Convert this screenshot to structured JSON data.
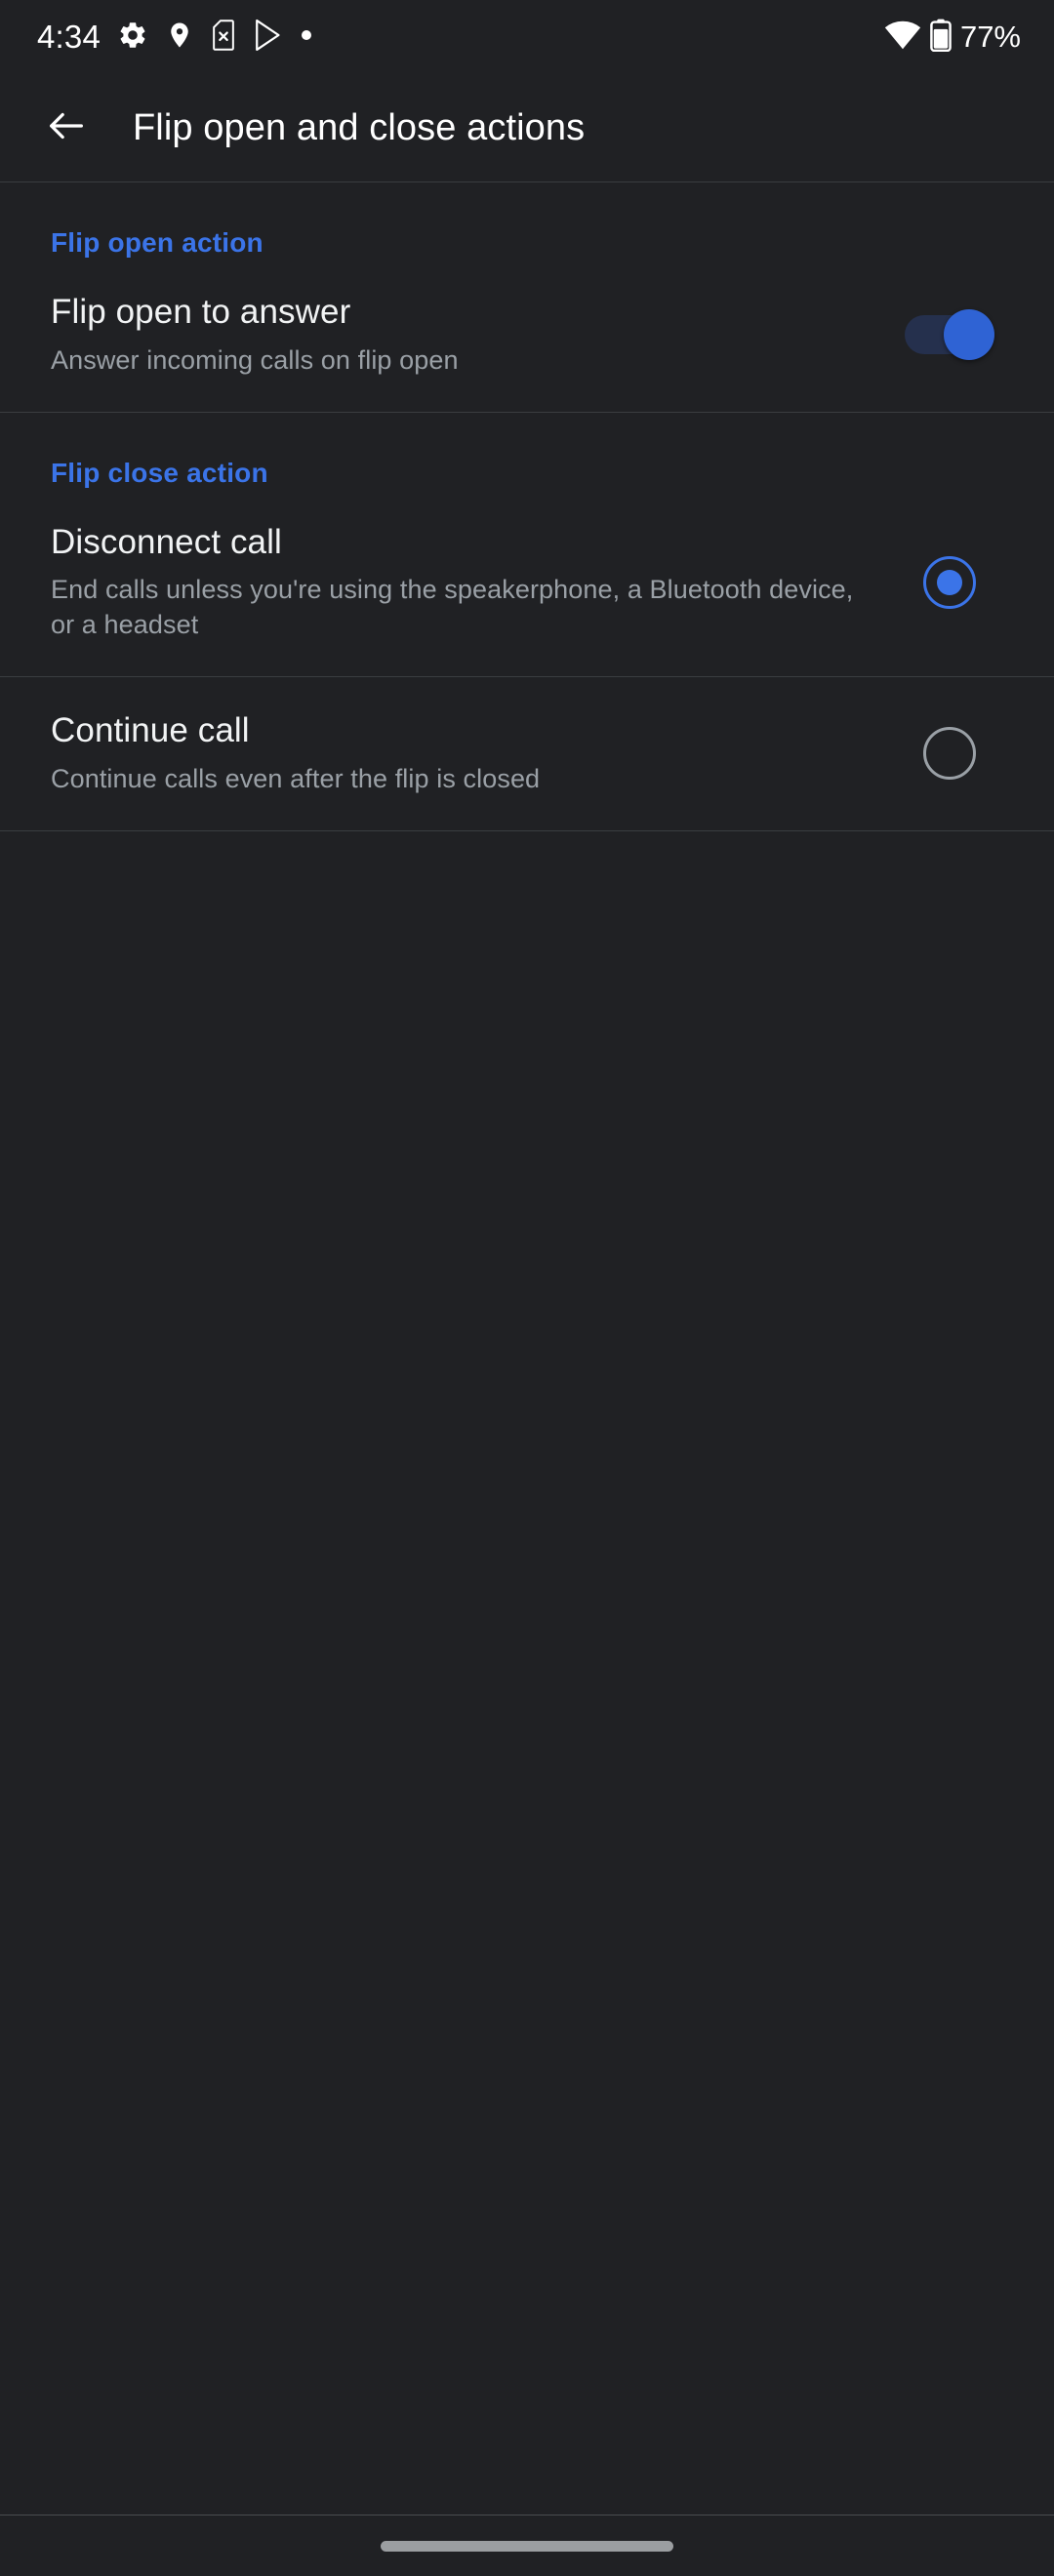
{
  "status_bar": {
    "clock": "4:34",
    "battery_percent": "77%",
    "left_icons": [
      "settings-gear-icon",
      "location-pin-icon",
      "sim-card-missing-icon",
      "play-store-icon",
      "dot-icon"
    ],
    "right_icons": [
      "wifi-icon",
      "battery-icon"
    ]
  },
  "app_bar": {
    "back_icon": "arrow-back-icon",
    "title": "Flip open and close actions"
  },
  "sections": [
    {
      "header": "Flip open action",
      "rows": [
        {
          "title": "Flip open to answer",
          "summary": "Answer incoming calls on flip open",
          "control": "switch",
          "checked": true
        }
      ]
    },
    {
      "header": "Flip close action",
      "rows": [
        {
          "title": "Disconnect call",
          "summary": "End calls unless you're using the speakerphone, a Bluetooth device, or a headset",
          "control": "radio",
          "checked": true
        },
        {
          "title": "Continue call",
          "summary": "Continue calls even after the flip is closed",
          "control": "radio",
          "checked": false
        }
      ]
    }
  ],
  "nav_bar": {
    "home_pill": "home-gesture-pill"
  },
  "colors": {
    "background": "#202124",
    "accent_blue": "#3b74e8",
    "switch_thumb": "#2f63d4",
    "switch_track": "#25304d",
    "primary_text": "#f1f3f4",
    "secondary_text": "#9aa0a6",
    "divider": "#3a3d40"
  }
}
